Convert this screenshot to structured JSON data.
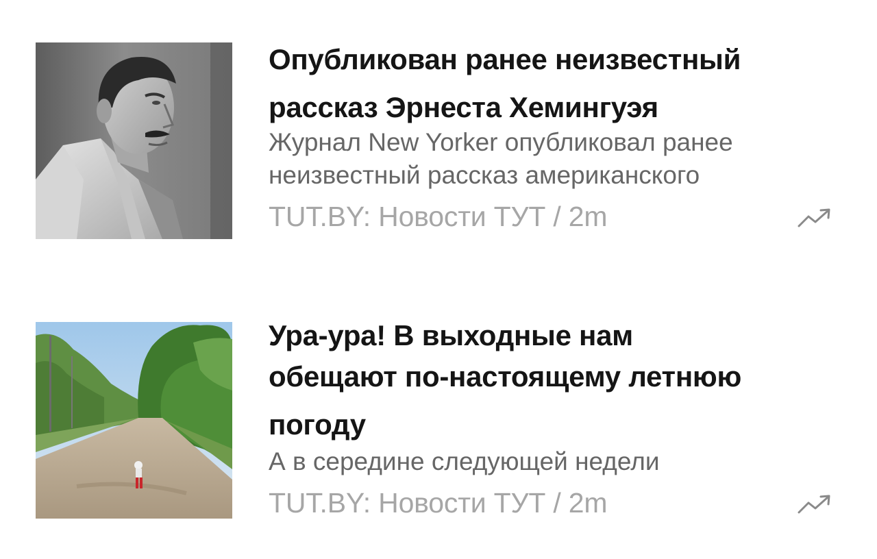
{
  "feed": {
    "items": [
      {
        "headline": "Опубликован ранее неизвестный рассказ Эрнеста Хемингуэя",
        "description_lines": [
          "Журнал New Yorker опубликовал ранее",
          "неизвестный рассказ американского"
        ],
        "source": "TUT.BY: Новости ТУТ",
        "time": "2m",
        "source_line": "TUT.BY: Новости ТУТ / 2m",
        "thumbnail": "portrait-photo",
        "trend_icon": "trending-up-icon"
      },
      {
        "headline_lines": [
          "Ура-ура! В выходные нам",
          "обещают по-настоящему летнюю",
          "погоду"
        ],
        "description": "А в середине следующей недели",
        "source": "TUT.BY: Новости ТУТ",
        "time": "2m",
        "source_line": "TUT.BY: Новости ТУТ / 2m",
        "thumbnail": "country-road-photo",
        "trend_icon": "trending-up-icon"
      }
    ]
  },
  "colors": {
    "headline": "#151515",
    "description": "#666666",
    "source": "#a6a6a6",
    "background": "#ffffff"
  }
}
